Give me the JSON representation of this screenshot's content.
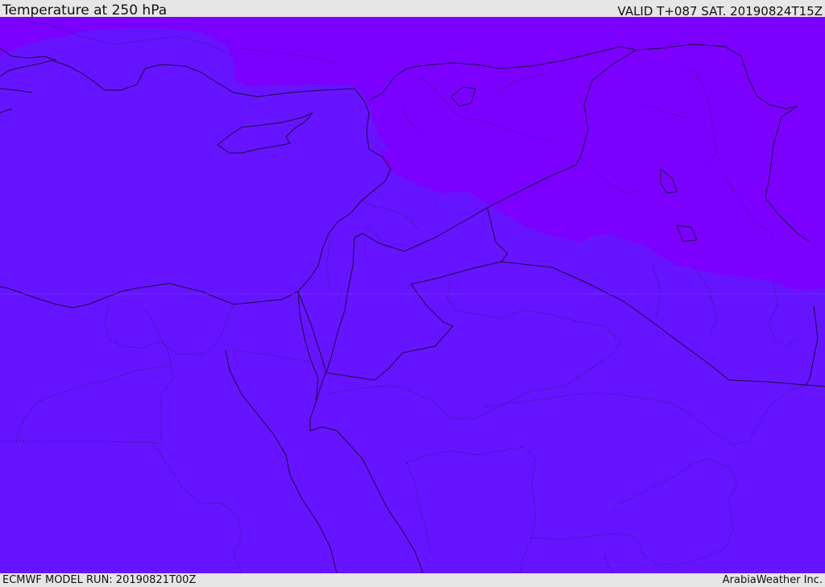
{
  "header": {
    "title": "Temperature at 250 hPa",
    "valid": "VALID T+087 SAT. 20190824T15Z"
  },
  "footer": {
    "model_run": "ECMWF MODEL RUN: 20190821T00Z",
    "credit": "ArabiaWeather Inc."
  },
  "map": {
    "field_colors": {
      "cold_band": "#7c00ff",
      "main_field": "#6614ff"
    }
  }
}
